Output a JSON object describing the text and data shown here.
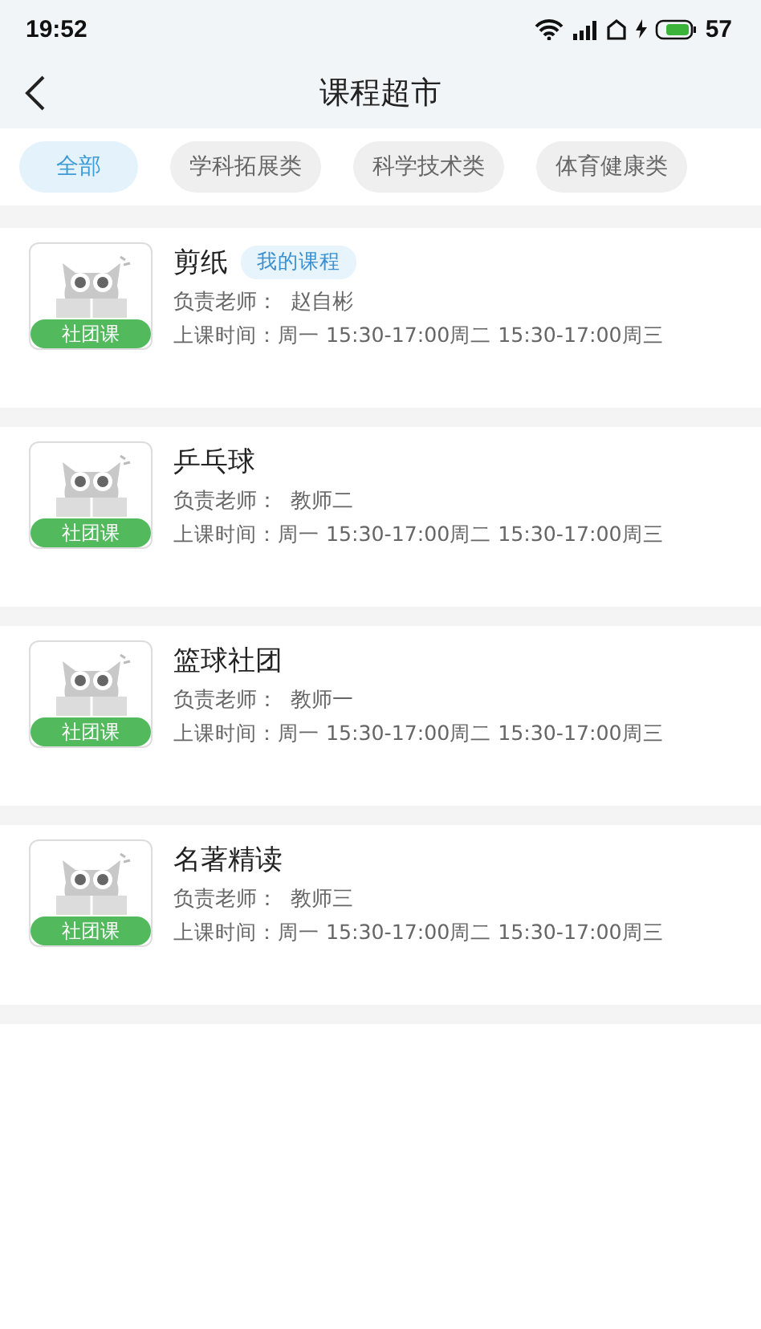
{
  "status_bar": {
    "time": "19:52",
    "battery": "57"
  },
  "nav": {
    "title": "课程超市"
  },
  "tabs": [
    {
      "label": "全部",
      "selected": true
    },
    {
      "label": "学科拓展类",
      "selected": false
    },
    {
      "label": "科学技术类",
      "selected": false
    },
    {
      "label": "体育健康类",
      "selected": false
    }
  ],
  "courses": [
    {
      "name": "剪纸",
      "badge": "我的课程",
      "tag": "社团课",
      "teacher_label": "负责老师：",
      "teacher": "赵自彬",
      "schedule": "上课时间：周一 15:30-17:00周二 15:30-17:00周三"
    },
    {
      "name": "乒乓球",
      "tag": "社团课",
      "teacher_label": "负责老师：",
      "teacher": "教师二",
      "schedule": "上课时间：周一 15:30-17:00周二 15:30-17:00周三"
    },
    {
      "name": "篮球社团",
      "tag": "社团课",
      "teacher_label": "负责老师：",
      "teacher": "教师一",
      "schedule": "上课时间：周一 15:30-17:00周二 15:30-17:00周三"
    },
    {
      "name": "名著精读",
      "tag": "社团课",
      "teacher_label": "负责老师：",
      "teacher": "教师三",
      "schedule": "上课时间：周一 15:30-17:00周二 15:30-17:00周三"
    }
  ]
}
